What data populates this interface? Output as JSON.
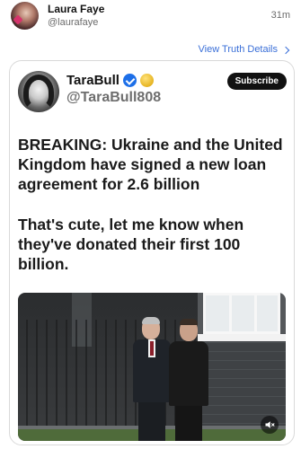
{
  "post": {
    "author_name": "Laura Faye",
    "author_handle": "@laurafaye",
    "timestamp": "31m",
    "view_details_label": "View Truth Details"
  },
  "quoted": {
    "name": "TaraBull",
    "handle": "@TaraBull808",
    "subscribe_label": "Subscribe",
    "paragraphs": [
      "BREAKING: Ukraine and the United Kingdom have signed a new loan agreement for 2.6 billion",
      "That's cute, let me know when they've donated their first 100 billion."
    ],
    "icons": {
      "verified": "verified-badge-icon",
      "gold": "gold-badge-icon",
      "mute": "mute-icon"
    },
    "colors": {
      "verified": "#1d6fe8",
      "link": "#3a6fd8",
      "subscribe_bg": "#111111"
    }
  }
}
